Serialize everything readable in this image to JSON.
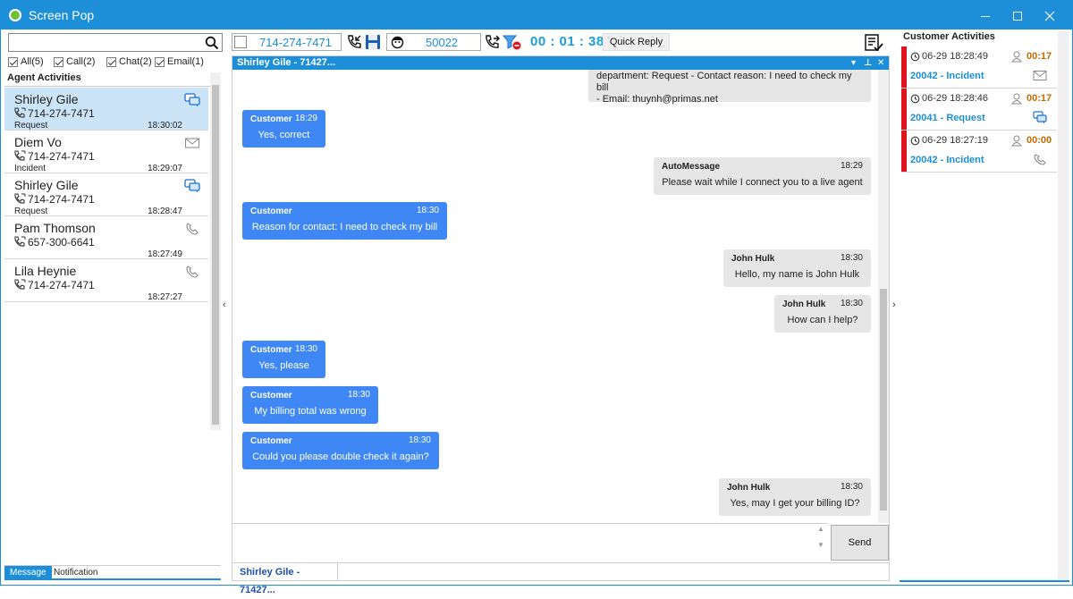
{
  "window": {
    "title": "Screen Pop"
  },
  "left": {
    "filters": [
      {
        "label": "All(5)"
      },
      {
        "label": "Call(2)"
      },
      {
        "label": "Chat(2)"
      },
      {
        "label": "Email(1)"
      }
    ],
    "agent_activities_title": "Agent Activities",
    "activities": [
      {
        "name": "Shirley Gile",
        "phone": "714-274-7471",
        "type": "Request",
        "time": "18:30:02",
        "icon": "chat-icon"
      },
      {
        "name": "Diem Vo",
        "phone": "714-274-7471",
        "type": "Incident",
        "time": "18:29:07",
        "icon": "email-icon"
      },
      {
        "name": "Shirley Gile",
        "phone": "714-274-7471",
        "type": "Request",
        "time": "18:28:47",
        "icon": "chat-icon"
      },
      {
        "name": "Pam Thomson",
        "phone": "657-300-6641",
        "type": "",
        "time": "18:27:49",
        "icon": "phone-icon"
      },
      {
        "name": "Lila Heynie",
        "phone": "714-274-7471",
        "type": "",
        "time": "18:27:27",
        "icon": "phone-icon"
      }
    ],
    "tabs": [
      {
        "label": "Message"
      },
      {
        "label": "Notification"
      }
    ]
  },
  "toolbar": {
    "phone": "714-274-7471",
    "agent_id": "50022",
    "timer": "00 : 01 : 38",
    "quick_reply": "Quick Reply"
  },
  "chat": {
    "header": "Shirley Gile - 71427...",
    "tab_label": "Shirley Gile - 71427...",
    "send_label": "Send",
    "messages": [
      {
        "lines": [
          "department: Request - Contact reason: I need to check my bill",
          "- Email: thuynh@primas.net"
        ]
      },
      {
        "sender": "Customer",
        "time": "18:29",
        "text": "Yes, correct"
      },
      {
        "sender": "AutoMessage",
        "time": "18:29",
        "text": "Please wait while I connect you to a live agent"
      },
      {
        "sender": "Customer",
        "time": "18:30",
        "text": "Reason for contact: I need to check my bill"
      },
      {
        "sender": "John Hulk",
        "time": "18:30",
        "text": "Hello, my name is John Hulk"
      },
      {
        "sender": "John Hulk",
        "time": "18:30",
        "text": "How can I help?"
      },
      {
        "sender": "Customer",
        "time": "18:30",
        "text": "Yes, please"
      },
      {
        "sender": "Customer",
        "time": "18:30",
        "text": "My billing total was wrong"
      },
      {
        "sender": "Customer",
        "time": "18:30",
        "text": "Could you please double check it again?"
      },
      {
        "sender": "John Hulk",
        "time": "18:30",
        "text": "Yes, may I get your billing ID?"
      }
    ]
  },
  "right": {
    "title": "Customer Activities",
    "items": [
      {
        "datetime": "06-29 18:28:49",
        "duration": "00:17",
        "title": "20042 - Incident",
        "icon": "email-icon"
      },
      {
        "datetime": "06-29 18:28:46",
        "duration": "00:17",
        "title": "20041 - Request",
        "icon": "chat-icon"
      },
      {
        "datetime": "06-29 18:27:19",
        "duration": "00:00",
        "title": "20042 - Incident",
        "icon": "phone-icon"
      }
    ]
  },
  "colors": {
    "accent": "#1c8fd8",
    "customer_bubble": "#3f87f5",
    "agent_bubble": "#e6e6e6",
    "alert": "#e0141e",
    "duration": "#c46a00"
  }
}
